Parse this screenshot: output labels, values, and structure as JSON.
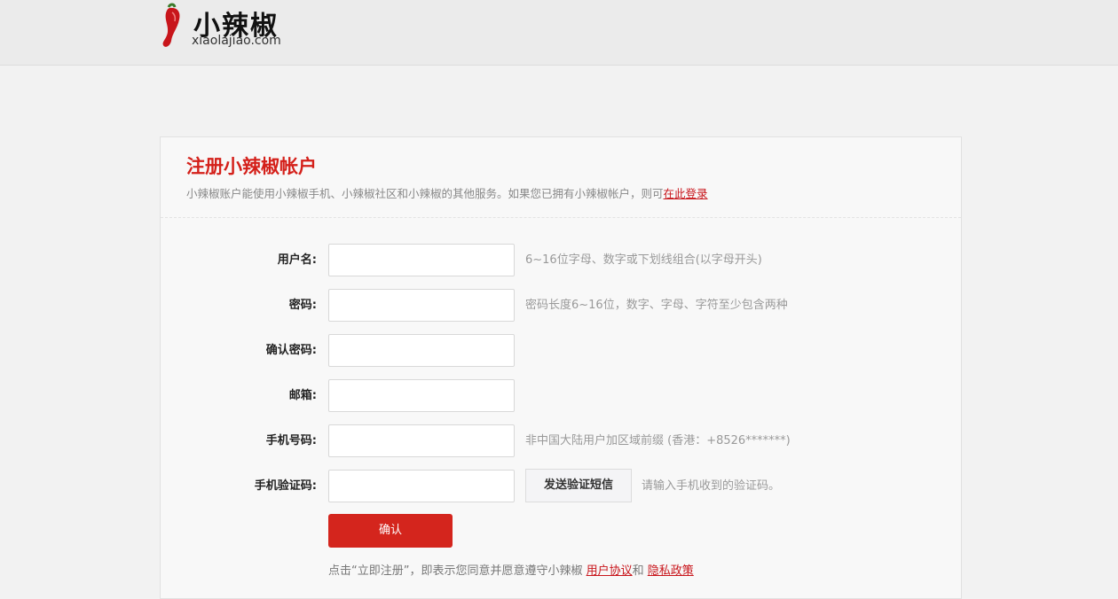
{
  "header": {
    "logo_cn": "小辣椒",
    "logo_en": "xiaolajiao.com"
  },
  "panel": {
    "title": "注册小辣椒帐户",
    "description": "小辣椒账户能使用小辣椒手机、小辣椒社区和小辣椒的其他服务。如果您已拥有小辣椒帐户，则可",
    "login_link": "在此登录"
  },
  "form": {
    "username": {
      "label": "用户名:",
      "value": "",
      "hint": "6~16位字母、数字或下划线组合(以字母开头)"
    },
    "password": {
      "label": "密码:",
      "value": "",
      "hint": "密码长度6~16位，数字、字母、字符至少包含两种"
    },
    "confirm_password": {
      "label": "确认密码:",
      "value": "",
      "hint": ""
    },
    "email": {
      "label": "邮箱:",
      "value": "",
      "hint": ""
    },
    "phone": {
      "label": "手机号码:",
      "value": "",
      "hint": "非中国大陆用户加区域前缀 (香港：+8526*******)"
    },
    "sms_code": {
      "label": "手机验证码:",
      "value": "",
      "button": "发送验证短信",
      "hint": "请输入手机收到的验证码。"
    },
    "submit_label": "确认"
  },
  "agreement": {
    "prefix": "点击“立即注册”，即表示您同意并愿意遵守小辣椒 ",
    "terms_link": "用户协议",
    "middle": "和 ",
    "privacy_link": "隐私政策"
  },
  "colors": {
    "brand_red": "#d4251d",
    "link_red": "#c8151b"
  }
}
